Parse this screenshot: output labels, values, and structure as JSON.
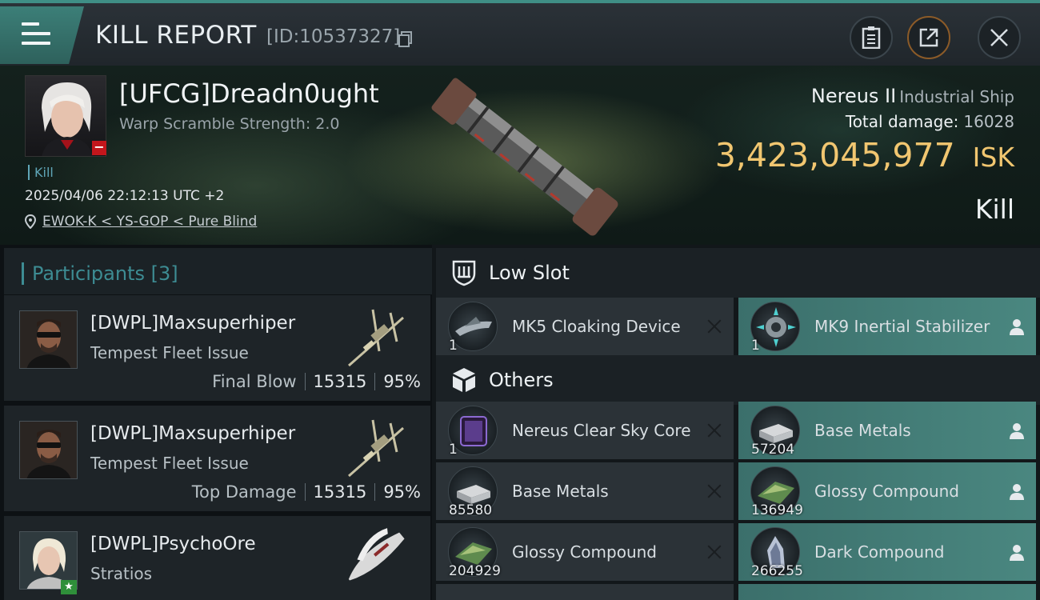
{
  "header": {
    "title": "KILL REPORT",
    "report_id": "[ID:10537327]"
  },
  "victim": {
    "name": "[UFCG]Dreadn0ught",
    "scramble": "Warp Scramble Strength: 2.0",
    "tag": "Kill",
    "date": "2025/04/06 22:12:13 UTC +2",
    "location": "EWOK-K < YS-GOP < Pure Blind",
    "ship_name": "Nereus II",
    "ship_class": "Industrial Ship",
    "total_damage_label": "Total damage:",
    "total_damage": "16028",
    "isk_value": "3,423,045,977",
    "isk_unit": "ISK",
    "result": "Kill"
  },
  "participants": {
    "title": "Participants",
    "count": "[3]",
    "list": [
      {
        "name": "[DWPL]Maxsuperhiper",
        "ship": "Tempest Fleet Issue",
        "label": "Final Blow",
        "damage": "15315",
        "percent": "95%"
      },
      {
        "name": "[DWPL]Maxsuperhiper",
        "ship": "Tempest Fleet Issue",
        "label": "Top Damage",
        "damage": "15315",
        "percent": "95%"
      },
      {
        "name": "[DWPL]PsychoOre",
        "ship": "Stratios"
      }
    ]
  },
  "low_slot": {
    "title": "Low Slot",
    "items": [
      {
        "name": "MK5 Cloaking Device",
        "qty": "1",
        "status": "destroyed"
      },
      {
        "name": "MK9 Inertial Stabilizer",
        "qty": "1",
        "status": "dropped"
      }
    ]
  },
  "others": {
    "title": "Others",
    "items": [
      {
        "name": "Nereus Clear Sky Core",
        "qty": "1",
        "status": "destroyed"
      },
      {
        "name": "Base Metals",
        "qty": "57204",
        "status": "dropped"
      },
      {
        "name": "Base Metals",
        "qty": "85580",
        "status": "destroyed"
      },
      {
        "name": "Glossy Compound",
        "qty": "136949",
        "status": "dropped"
      },
      {
        "name": "Glossy Compound",
        "qty": "204929",
        "status": "destroyed"
      },
      {
        "name": "Dark Compound",
        "qty": "266255",
        "status": "dropped"
      }
    ]
  },
  "colors": {
    "accent_teal": "#3d8c93",
    "isk_gold": "#f1c670",
    "dropped_bg": "#4a8780",
    "badge_red": "#c3161c"
  },
  "icons": [
    "menu-icon",
    "copy-icon",
    "clipboard-icon",
    "share-icon",
    "close-icon",
    "location-pin-icon",
    "low-slot-icon",
    "others-cube-icon",
    "destroyed-x-icon",
    "person-icon"
  ]
}
